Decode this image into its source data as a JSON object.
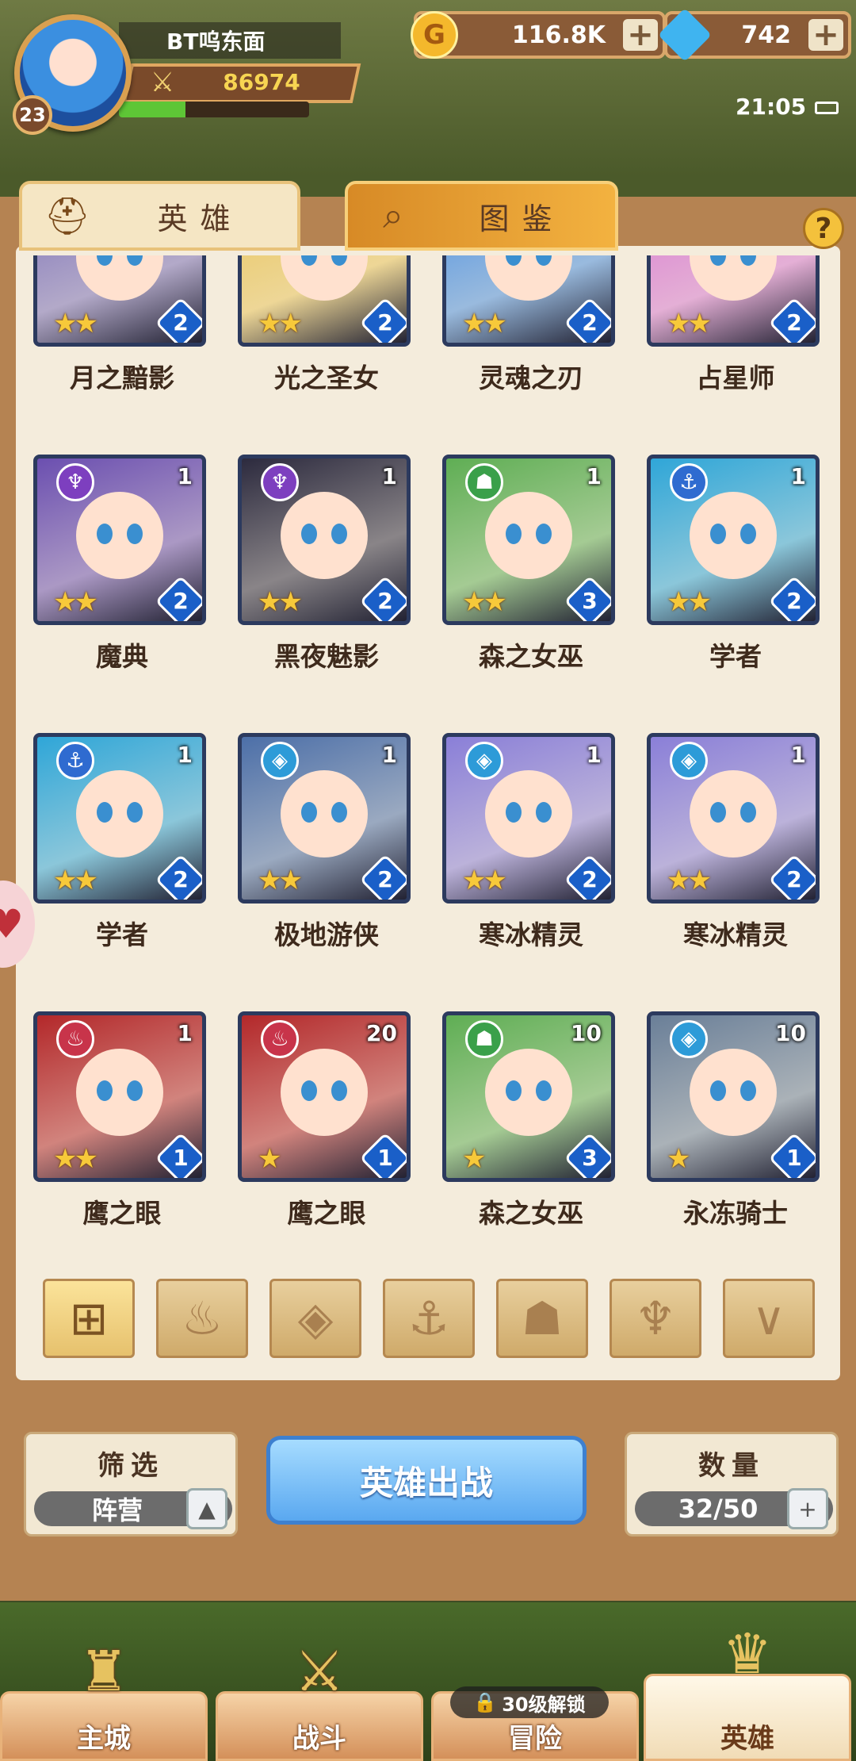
{
  "player": {
    "name": "BT呜东面",
    "level": "23",
    "power": "86974",
    "xp_fraction": 0.35
  },
  "resources": {
    "gold": "116.8K",
    "gems": "742"
  },
  "status": {
    "time": "21:05"
  },
  "tabs": {
    "hero": "英雄",
    "dex": "图鉴"
  },
  "help_label": "?",
  "heroes": [
    {
      "name": "月之黯影",
      "stars": 2,
      "grade": "2",
      "count": "",
      "faction_icon": "",
      "color": "#7a6fb8"
    },
    {
      "name": "光之圣女",
      "stars": 2,
      "grade": "2",
      "count": "",
      "faction_icon": "",
      "color": "#e8c45a"
    },
    {
      "name": "灵魂之刃",
      "stars": 2,
      "grade": "2",
      "count": "",
      "faction_icon": "",
      "color": "#4a8fe0"
    },
    {
      "name": "占星师",
      "stars": 2,
      "grade": "2",
      "count": "",
      "faction_icon": "",
      "color": "#d77ad0"
    },
    {
      "name": "魔典",
      "stars": 2,
      "grade": "2",
      "count": "1",
      "faction_icon": "demon-icon",
      "faction_color": "#7d3fbf",
      "color": "#6b4fb0"
    },
    {
      "name": "黑夜魅影",
      "stars": 2,
      "grade": "2",
      "count": "1",
      "faction_icon": "demon-icon",
      "faction_color": "#7d3fbf",
      "color": "#2c2a3e"
    },
    {
      "name": "森之女巫",
      "stars": 2,
      "grade": "3",
      "count": "1",
      "faction_icon": "beast-icon",
      "faction_color": "#3aa04a",
      "color": "#5fae54"
    },
    {
      "name": "学者",
      "stars": 2,
      "grade": "2",
      "count": "1",
      "faction_icon": "anchor-icon",
      "faction_color": "#2f6bd0",
      "color": "#2fa6d8"
    },
    {
      "name": "学者",
      "stars": 2,
      "grade": "2",
      "count": "1",
      "faction_icon": "anchor-icon",
      "faction_color": "#2f6bd0",
      "color": "#2fa6d8"
    },
    {
      "name": "极地游侠",
      "stars": 2,
      "grade": "2",
      "count": "1",
      "faction_icon": "ice-icon",
      "faction_color": "#2d9bd8",
      "color": "#4c6fa8"
    },
    {
      "name": "寒冰精灵",
      "stars": 2,
      "grade": "2",
      "count": "1",
      "faction_icon": "ice-icon",
      "faction_color": "#2d9bd8",
      "color": "#8a7fd8"
    },
    {
      "name": "寒冰精灵",
      "stars": 2,
      "grade": "2",
      "count": "1",
      "faction_icon": "ice-icon",
      "faction_color": "#2d9bd8",
      "color": "#8a7fd8"
    },
    {
      "name": "鹰之眼",
      "stars": 2,
      "grade": "1",
      "count": "1",
      "faction_icon": "fire-icon",
      "faction_color": "#c8344a",
      "color": "#b3282a"
    },
    {
      "name": "鹰之眼",
      "stars": 1,
      "grade": "1",
      "count": "20",
      "faction_icon": "fire-icon",
      "faction_color": "#c8344a",
      "color": "#b3282a"
    },
    {
      "name": "森之女巫",
      "stars": 1,
      "grade": "3",
      "count": "10",
      "faction_icon": "beast-icon",
      "faction_color": "#3aa04a",
      "color": "#5fae54"
    },
    {
      "name": "永冻骑士",
      "stars": 1,
      "grade": "1",
      "count": "10",
      "faction_icon": "ice-icon",
      "faction_color": "#2d9bd8",
      "color": "#6a7f98"
    }
  ],
  "filters": [
    {
      "icon": "grid-icon",
      "glyph": "⊞",
      "active": true
    },
    {
      "icon": "fire-faction-icon",
      "glyph": "♨",
      "active": false
    },
    {
      "icon": "ice-faction-icon",
      "glyph": "◈",
      "active": false
    },
    {
      "icon": "anchor-faction-icon",
      "glyph": "⚓",
      "active": false
    },
    {
      "icon": "beast-faction-icon",
      "glyph": "☗",
      "active": false
    },
    {
      "icon": "demon-faction-icon",
      "glyph": "♆",
      "active": false
    },
    {
      "icon": "horn-faction-icon",
      "glyph": "∨",
      "active": false
    }
  ],
  "controls": {
    "filter_title": "筛选",
    "filter_value": "阵营",
    "deploy_label": "英雄出战",
    "count_title": "数量",
    "count_value": "32/50"
  },
  "nav": {
    "main_city": "主城",
    "battle": "战斗",
    "adventure": "冒险",
    "hero": "英雄",
    "adventure_lock": "30级解锁"
  }
}
